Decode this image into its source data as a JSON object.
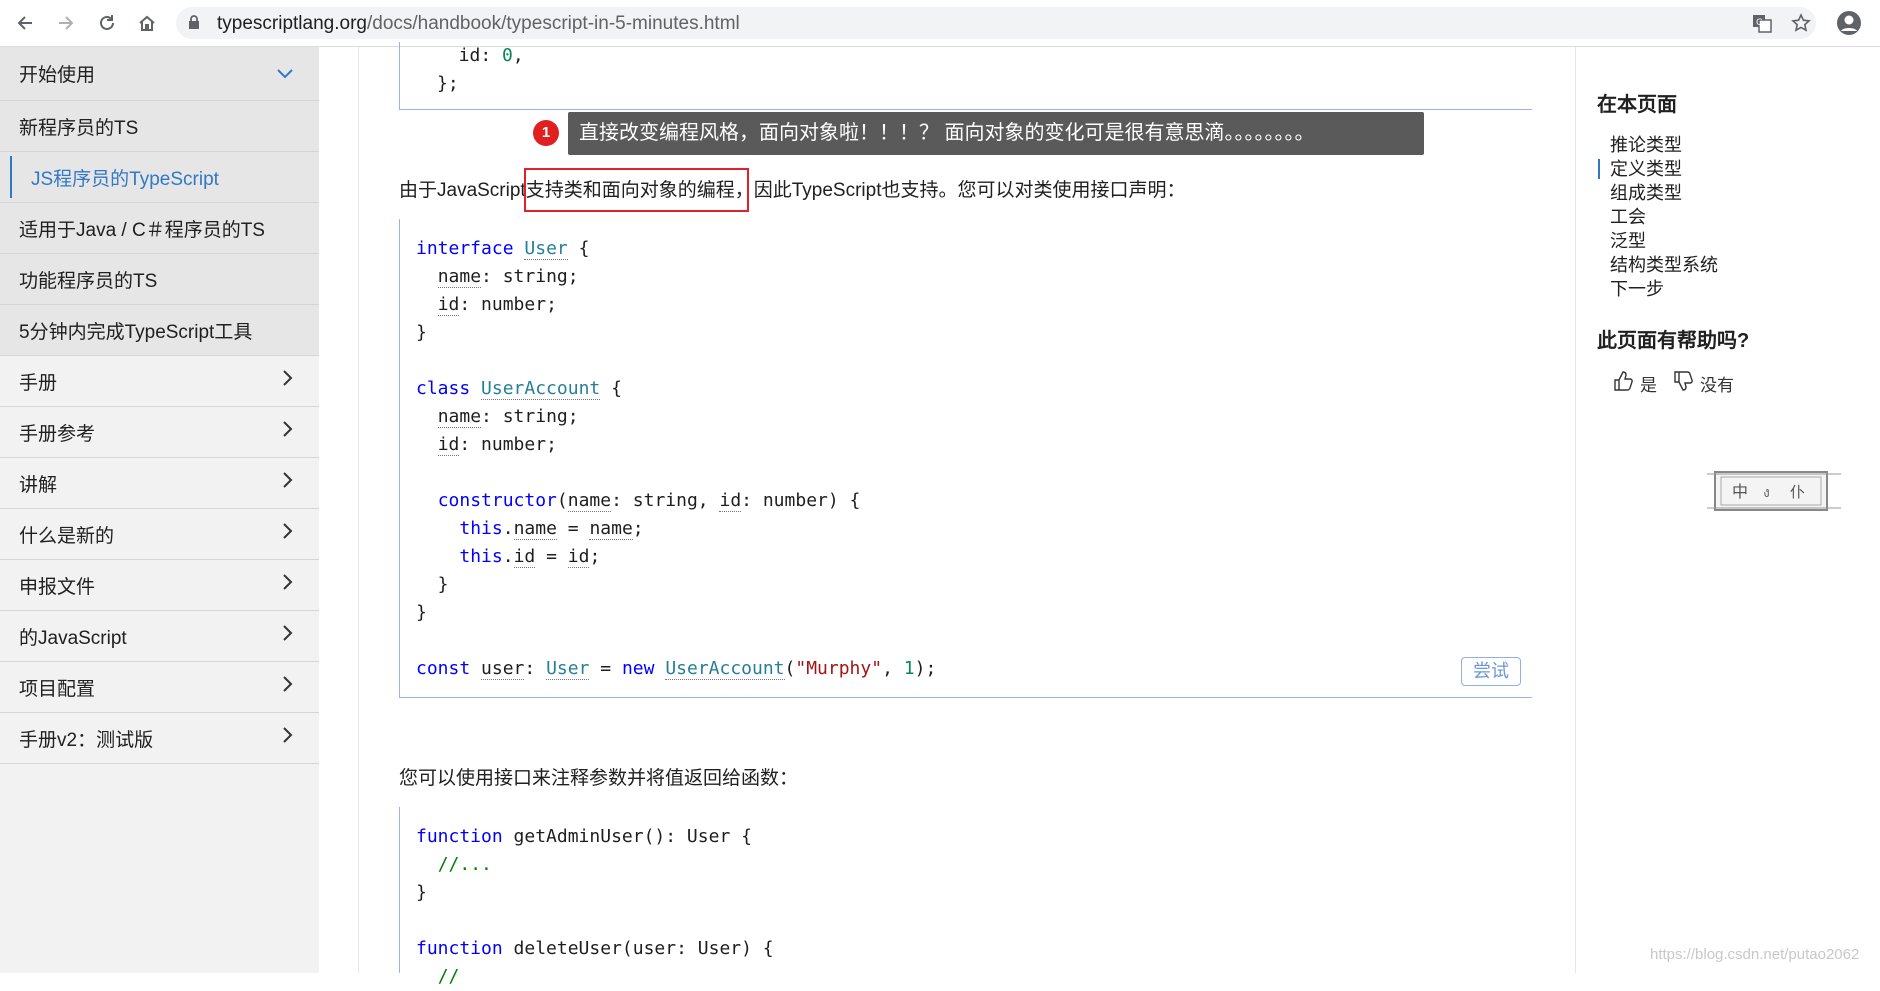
{
  "browser": {
    "url_domain": "typescriptlang.org",
    "url_path": "/docs/handbook/typescript-in-5-minutes.html"
  },
  "sidebar": {
    "section_open": "开始使用",
    "sub_items": [
      {
        "label": "新程序员的TS",
        "active": false
      },
      {
        "label": "JS程序员的TypeScript",
        "active": true
      },
      {
        "label": "适用于Java / C＃程序员的TS",
        "active": false
      },
      {
        "label": "功能程序员的TS",
        "active": false
      },
      {
        "label": "5分钟内完成TypeScript工具",
        "active": false
      }
    ],
    "sections": [
      "手册",
      "手册参考",
      "讲解",
      "什么是新的",
      "申报文件",
      "的JavaScript",
      "项目配置",
      "手册v2：测试版"
    ]
  },
  "content": {
    "code_top": [
      "  id: 0,",
      "};"
    ],
    "tooltip_badge": "1",
    "tooltip_text": "直接改变编程风格，面向对象啦！！！？     面向对象的变化可是很有意思滴。。。。。。。。",
    "para1_pre": "由于JavaScript",
    "para1_highlight": "支持类和面向对象的编程",
    "para1_post": "，因此TypeScript也支持。您可以对类使用接口声明：",
    "try_button": "尝试",
    "para2": "您可以使用接口来注释参数并将值返回给函数：",
    "code2_comment": "//..."
  },
  "toc": {
    "title": "在本页面",
    "items": [
      "推论类型",
      "定义类型",
      "组成类型",
      "工会",
      "泛型",
      "结构类型系统",
      "下一步"
    ],
    "selected_index": 1,
    "help_title": "此页面有帮助吗?",
    "yes_label": "是",
    "no_label": "没有"
  },
  "watermark": "https://blog.csdn.net/putao2062",
  "colors": {
    "accent": "#3178c6",
    "keyword": "#0000ff",
    "type": "#267f99",
    "string": "#a31515",
    "highlight_box": "#e0202a"
  }
}
